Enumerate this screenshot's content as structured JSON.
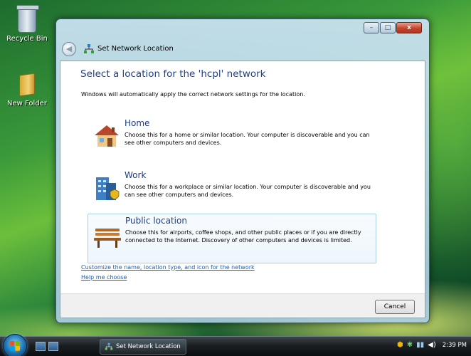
{
  "desktop": {
    "icons": [
      {
        "label": "Recycle Bin",
        "icon": "recycle-bin-icon"
      },
      {
        "label": "New Folder",
        "icon": "folder-icon"
      }
    ]
  },
  "window": {
    "title": "Set Network Location",
    "caption": {
      "minimize": "–",
      "maximize": "□",
      "close": "x"
    },
    "heading": "Select a location for the 'hcpl' network",
    "subline": "Windows will automatically apply the correct network settings for the location.",
    "options": [
      {
        "title": "Home",
        "icon": "house-icon",
        "description": "Choose this for a home or similar location. Your computer is discoverable and you can see other computers and devices."
      },
      {
        "title": "Work",
        "icon": "office-building-icon",
        "description": "Choose this for a workplace or similar location. Your computer is discoverable and you can see other computers and devices."
      },
      {
        "title": "Public location",
        "icon": "park-bench-icon",
        "description": "Choose this for airports, coffee shops, and other public places or if you are directly connected to the Internet. Discovery of other computers and devices is limited.",
        "selected": true
      }
    ],
    "links": {
      "customize": "Customize the name, location type, and icon for the network",
      "help": "Help me choose"
    },
    "cancel_label": "Cancel"
  },
  "taskbar": {
    "task_label": "Set Network Location",
    "clock": "2:39 PM"
  },
  "colors": {
    "heading": "#1e3e8a",
    "link": "#1a5fb4",
    "selected_border": "#a9cfe8"
  }
}
